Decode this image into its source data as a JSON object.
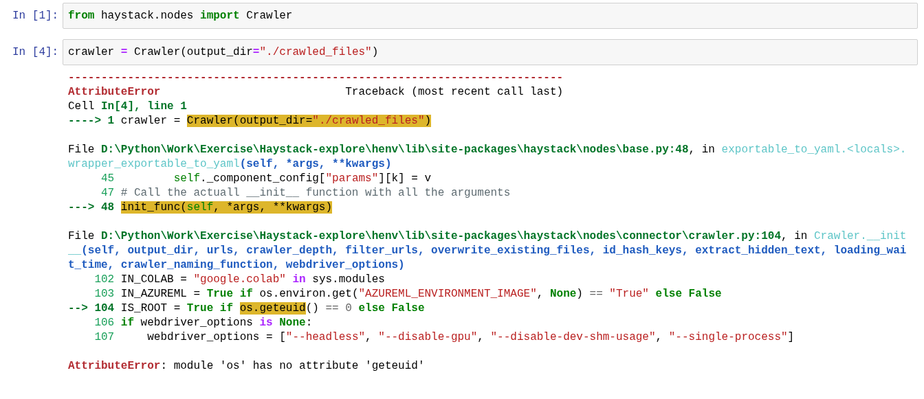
{
  "cells": [
    {
      "prompt": "In [1]:",
      "code": [
        {
          "kind": "keyword",
          "text": "from"
        },
        {
          "kind": "text",
          "text": " haystack.nodes "
        },
        {
          "kind": "keyword",
          "text": "import"
        },
        {
          "kind": "text",
          "text": " Crawler"
        }
      ]
    },
    {
      "prompt": "In [4]:",
      "code": [
        {
          "kind": "text",
          "text": "crawler "
        },
        {
          "kind": "operator",
          "text": "="
        },
        {
          "kind": "text",
          "text": " Crawler(output_dir"
        },
        {
          "kind": "operator",
          "text": "="
        },
        {
          "kind": "string",
          "text": "\"./crawled_files\""
        },
        {
          "kind": "text",
          "text": ")"
        }
      ],
      "output": [
        [
          [
            {
              "kind": "error",
              "text": "---------------------------------------------------------------------------"
            }
          ],
          [
            {
              "kind": "error",
              "text": "AttributeError"
            },
            {
              "kind": "text",
              "text": "                            Traceback (most recent call last)"
            }
          ],
          [
            {
              "kind": "text",
              "text": "Cell "
            },
            {
              "kind": "path",
              "text": "In[4], line 1"
            }
          ],
          [
            {
              "kind": "current-line",
              "text": "----> 1"
            },
            {
              "kind": "text",
              "text": " crawler = "
            },
            {
              "kind": "highlight",
              "tokens": [
                {
                  "kind": "text",
                  "text": "Crawler(output_dir="
                },
                {
                  "kind": "string",
                  "text": "\"./crawled_files\""
                },
                {
                  "kind": "text",
                  "text": ")"
                }
              ]
            }
          ]
        ],
        [
          [
            {
              "kind": "text",
              "text": "File "
            },
            {
              "kind": "path",
              "text": "D:\\Python\\Work\\Exercise\\Haystack-explore\\henv\\lib\\site-packages\\haystack\\nodes\\base.py:48"
            },
            {
              "kind": "text",
              "text": ", in "
            },
            {
              "kind": "function",
              "text": "exportable_to_yaml.<locals>."
            }
          ],
          [
            {
              "kind": "function",
              "text": "wrapper_exportable_to_yaml"
            },
            {
              "kind": "signature",
              "text": "(self, *args, **kwargs)"
            }
          ],
          [
            {
              "kind": "line-number",
              "text": "     45         "
            },
            {
              "kind": "builtin",
              "text": "self"
            },
            {
              "kind": "text",
              "text": "._component_config["
            },
            {
              "kind": "string",
              "text": "\"params\""
            },
            {
              "kind": "text",
              "text": "][k] = v"
            }
          ],
          [
            {
              "kind": "line-number",
              "text": "     47 "
            },
            {
              "kind": "comment",
              "text": "# Call the actuall __init__ function with all the arguments"
            }
          ],
          [
            {
              "kind": "current-line",
              "text": "---> 48 "
            },
            {
              "kind": "highlight",
              "tokens": [
                {
                  "kind": "text",
                  "text": "init_func("
                },
                {
                  "kind": "builtin",
                  "text": "self"
                },
                {
                  "kind": "text",
                  "text": ", *args, **kwargs)"
                }
              ]
            }
          ]
        ],
        [
          [
            {
              "kind": "text",
              "text": "File "
            },
            {
              "kind": "path",
              "text": "D:\\Python\\Work\\Exercise\\Haystack-explore\\henv\\lib\\site-packages\\haystack\\nodes\\connector\\crawler.py:104"
            },
            {
              "kind": "text",
              "text": ", in "
            },
            {
              "kind": "function",
              "text": "Crawler.__init"
            }
          ],
          [
            {
              "kind": "function",
              "text": "__"
            },
            {
              "kind": "signature",
              "text": "(self, output_dir, urls, crawler_depth, filter_urls, overwrite_existing_files, id_hash_keys, extract_hidden_text, loading_wai"
            }
          ],
          [
            {
              "kind": "signature",
              "text": "t_time, crawler_naming_function, webdriver_options)"
            }
          ],
          [
            {
              "kind": "line-number",
              "text": "    102"
            },
            {
              "kind": "text",
              "text": " IN_COLAB = "
            },
            {
              "kind": "string",
              "text": "\"google.colab\" "
            },
            {
              "kind": "operator",
              "text": "in"
            },
            {
              "kind": "text",
              "text": " sys.modules"
            }
          ],
          [
            {
              "kind": "line-number",
              "text": "    103"
            },
            {
              "kind": "text",
              "text": " IN_AZUREML = "
            },
            {
              "kind": "keyword",
              "text": "True if"
            },
            {
              "kind": "text",
              "text": " os.environ.get("
            },
            {
              "kind": "string",
              "text": "\"AZUREML_ENVIRONMENT_IMAGE\""
            },
            {
              "kind": "text",
              "text": ", "
            },
            {
              "kind": "keyword",
              "text": "None"
            },
            {
              "kind": "text",
              "text": ") "
            },
            {
              "kind": "dim",
              "text": "== "
            },
            {
              "kind": "string",
              "text": "\"True\" "
            },
            {
              "kind": "keyword",
              "text": "else False"
            }
          ],
          [
            {
              "kind": "current-line",
              "text": "--> 104"
            },
            {
              "kind": "text",
              "text": " IS_ROOT = "
            },
            {
              "kind": "keyword",
              "text": "True if "
            },
            {
              "kind": "highlight",
              "tokens": [
                {
                  "kind": "text",
                  "text": "os.geteuid"
                }
              ]
            },
            {
              "kind": "text",
              "text": "() "
            },
            {
              "kind": "dim",
              "text": "== 0 "
            },
            {
              "kind": "keyword",
              "text": "else False"
            }
          ],
          [
            {
              "kind": "line-number",
              "text": "    106 "
            },
            {
              "kind": "keyword",
              "text": "if"
            },
            {
              "kind": "text",
              "text": " webdriver_options "
            },
            {
              "kind": "operator",
              "text": "is "
            },
            {
              "kind": "keyword",
              "text": "None"
            },
            {
              "kind": "text",
              "text": ":"
            }
          ],
          [
            {
              "kind": "line-number",
              "text": "    107"
            },
            {
              "kind": "text",
              "text": "     webdriver_options = ["
            },
            {
              "kind": "string",
              "text": "\"--headless\""
            },
            {
              "kind": "text",
              "text": ", "
            },
            {
              "kind": "string",
              "text": "\"--disable-gpu\""
            },
            {
              "kind": "text",
              "text": ", "
            },
            {
              "kind": "string",
              "text": "\"--disable-dev-shm-usage\""
            },
            {
              "kind": "text",
              "text": ", "
            },
            {
              "kind": "string",
              "text": "\"--single-process\""
            },
            {
              "kind": "text",
              "text": "]"
            }
          ]
        ],
        [
          [
            {
              "kind": "error",
              "text": "AttributeError"
            },
            {
              "kind": "text",
              "text": ": module 'os' has no attribute 'geteuid'"
            }
          ]
        ]
      ]
    }
  ]
}
